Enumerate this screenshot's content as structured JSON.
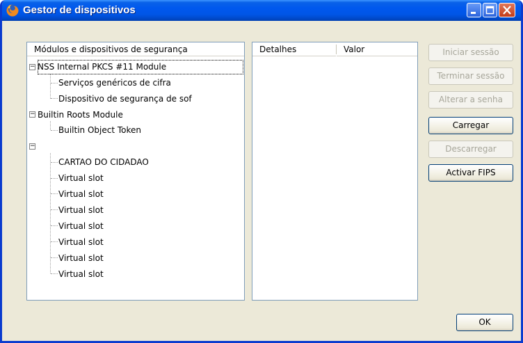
{
  "window": {
    "title": "Gestor de dispositivos"
  },
  "tree": {
    "header": "Módulos e dispositivos de segurança",
    "nodes": [
      {
        "label": "NSS Internal PKCS #11 Module",
        "level": 0,
        "expanded": true,
        "selected": true
      },
      {
        "label": "Serviços genéricos de cifra",
        "level": 1
      },
      {
        "label": "Dispositivo de segurança de sof",
        "level": 1
      },
      {
        "label": "Builtin Roots Module",
        "level": 0,
        "expanded": true
      },
      {
        "label": "Builtin Object Token",
        "level": 1
      },
      {
        "label": "",
        "level": 0,
        "expanded": true
      },
      {
        "label": "CARTAO DO CIDADAO",
        "level": 1
      },
      {
        "label": "Virtual slot",
        "level": 1
      },
      {
        "label": "Virtual slot",
        "level": 1
      },
      {
        "label": "Virtual slot",
        "level": 1
      },
      {
        "label": "Virtual slot",
        "level": 1
      },
      {
        "label": "Virtual slot",
        "level": 1
      },
      {
        "label": "Virtual slot",
        "level": 1
      },
      {
        "label": "Virtual slot",
        "level": 1
      }
    ]
  },
  "details": {
    "col_details": "Detalhes",
    "col_value": "Valor"
  },
  "buttons": {
    "login": {
      "label": "Iniciar sessão",
      "enabled": false
    },
    "logout": {
      "label": "Terminar sessão",
      "enabled": false
    },
    "change_password": {
      "label": "Alterar a senha",
      "enabled": false
    },
    "load": {
      "label": "Carregar",
      "enabled": true
    },
    "unload": {
      "label": "Descarregar",
      "enabled": false
    },
    "fips": {
      "label": "Activar FIPS",
      "enabled": true
    },
    "ok": {
      "label": "OK",
      "enabled": true
    }
  },
  "icons": {
    "app": "firefox-icon",
    "minimize": "minimize-icon",
    "maximize": "maximize-icon",
    "close": "close-icon",
    "expander": "collapse-icon"
  },
  "colors": {
    "titlebar": "#0055e6",
    "window_bg": "#ece9d8",
    "pane_border": "#7f9db9",
    "disabled_text": "#a7a69a"
  }
}
